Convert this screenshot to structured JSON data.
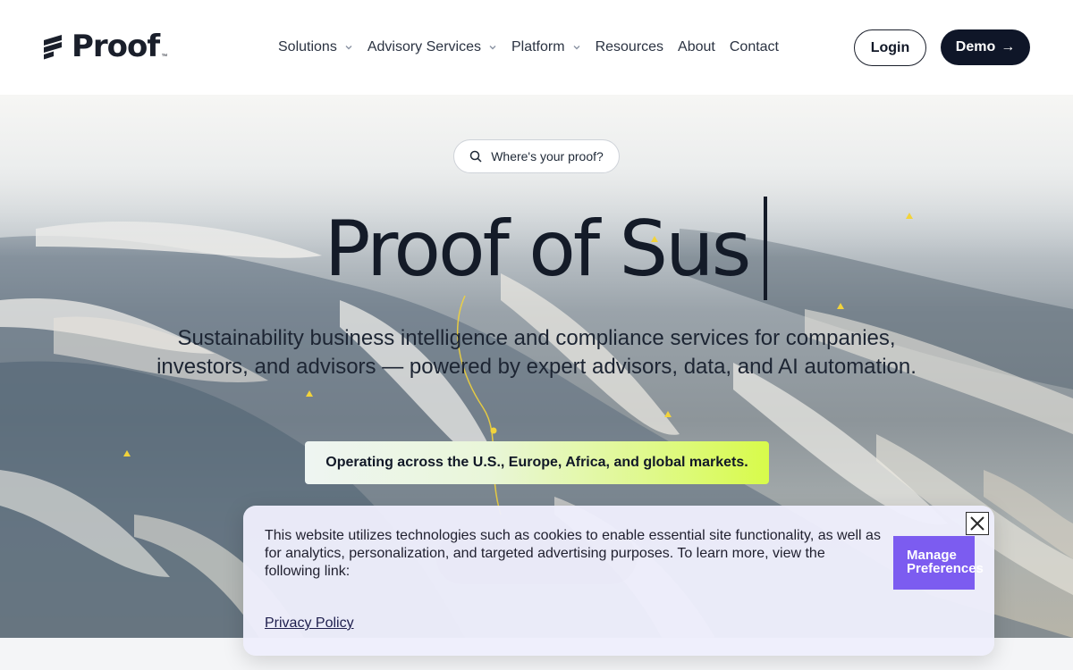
{
  "header": {
    "logo_text": "Proof",
    "logo_tm": "™",
    "nav": [
      {
        "label": "Solutions",
        "dropdown": true
      },
      {
        "label": "Advisory Services",
        "dropdown": true
      },
      {
        "label": "Platform",
        "dropdown": true
      },
      {
        "label": "Resources",
        "dropdown": false
      },
      {
        "label": "About",
        "dropdown": false
      },
      {
        "label": "Contact",
        "dropdown": false
      }
    ],
    "login_label": "Login",
    "demo_label": "Demo",
    "demo_arrow": "→"
  },
  "hero": {
    "search_label": "Where's your proof?",
    "title": "Proof of Sus",
    "subtitle": "Sustainability business intelligence and compliance services for companies, investors,  and advisors — powered by expert advisors, data, and AI automation.",
    "markets": "Operating across the U.S., Europe, Africa, and global markets."
  },
  "cookie_banner": {
    "text": "This website utilizes technologies such as cookies to enable essential site functionality, as well as for analytics, personalization, and targeted advertising purposes. To learn more, view the following link:",
    "privacy_link": "Privacy Policy",
    "manage_label": "Manage Preferences"
  },
  "colors": {
    "brand_dark": "#0f1628",
    "accent_lime": "#d8fb4a",
    "manage_purple": "#7c5cf0",
    "marker_yellow": "#f2d33b"
  }
}
